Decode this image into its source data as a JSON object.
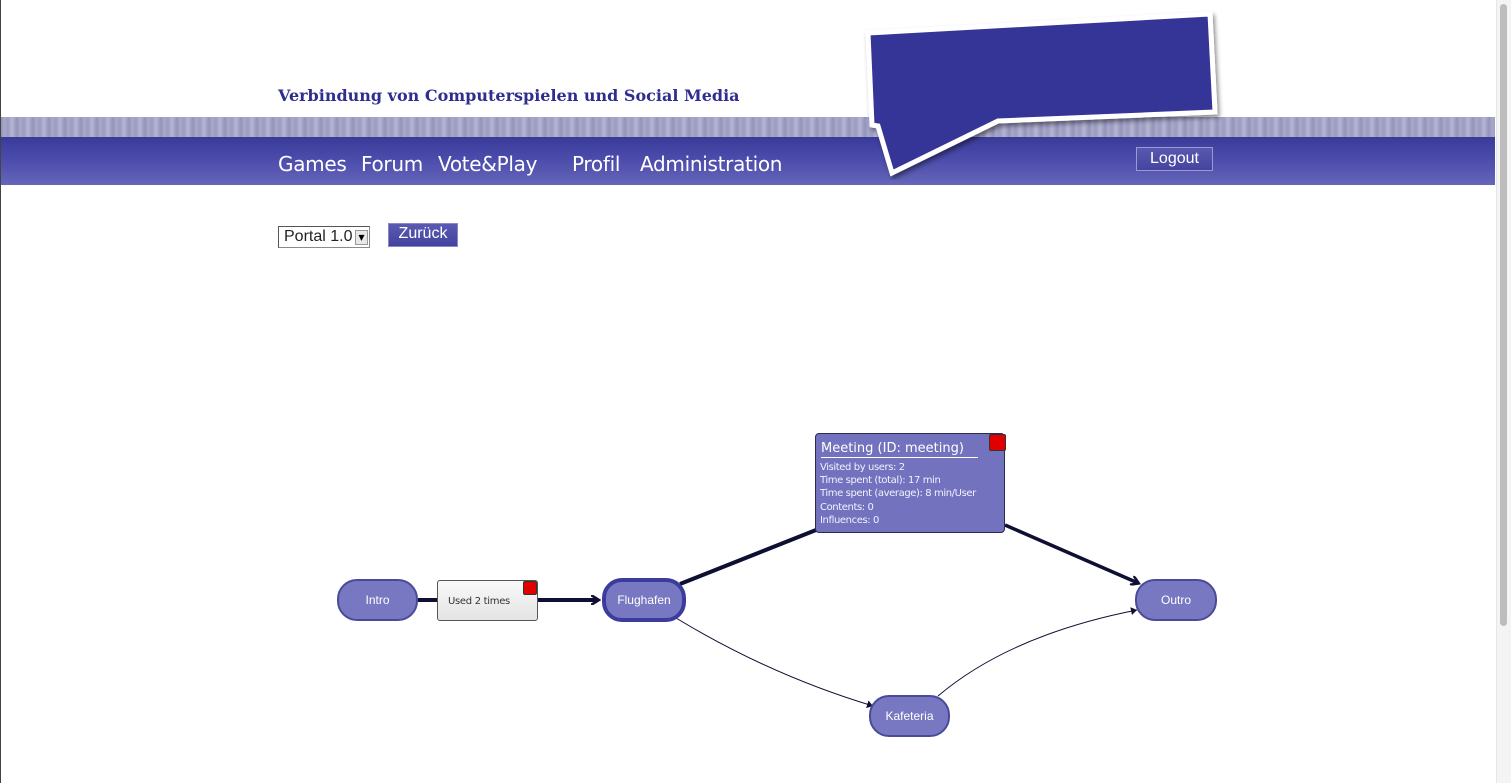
{
  "header": {
    "site_title": "Verbindung von Computerspielen und Social Media"
  },
  "nav": {
    "items": [
      "Games",
      "Forum",
      "Vote&Play",
      "Profil",
      "Administration"
    ],
    "logout_label": "Logout"
  },
  "toolbar": {
    "version_select_value": "Portal 1.0",
    "back_label": "Zurück"
  },
  "graph": {
    "nodes": {
      "intro": "Intro",
      "flughafen": "Flughafen",
      "kafeteria": "Kafeteria",
      "outro": "Outro"
    },
    "edge_label": "Used 2 times",
    "info_box": {
      "title": "Meeting (ID: meeting)",
      "lines": [
        "Visited by users: 2",
        "Time spent (total): 17 min",
        "Time spent (average): 8 min/User",
        "Contents: 0",
        "Influences: 0"
      ]
    }
  },
  "colors": {
    "brand": "#3a3a99",
    "node_fill": "#7878c2",
    "close_marker": "#e00000"
  }
}
